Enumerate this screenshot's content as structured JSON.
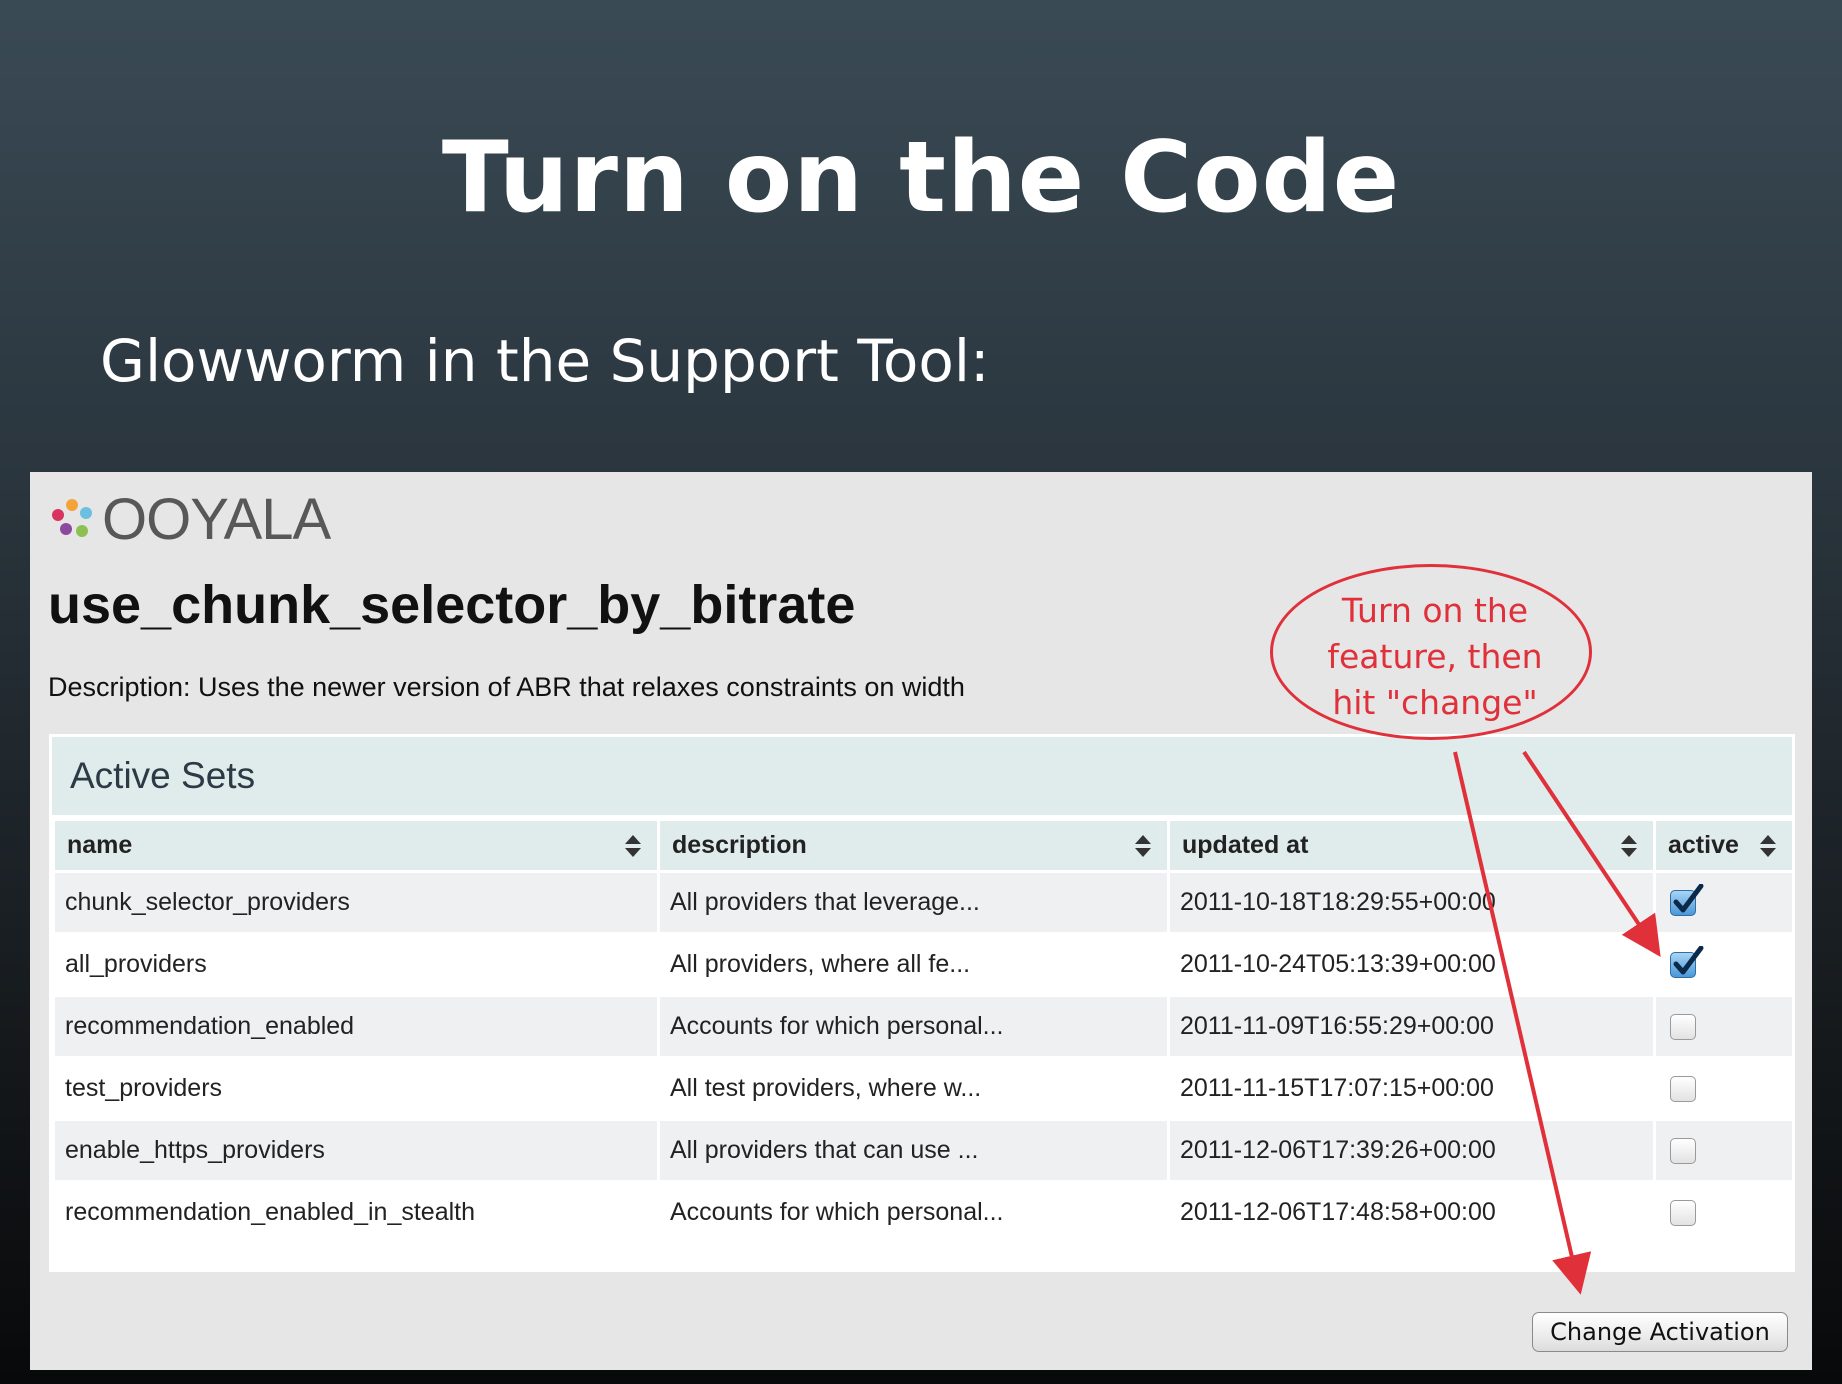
{
  "slide": {
    "title": "Turn on the Code",
    "subtitle": "Glowworm in the Support Tool:"
  },
  "app": {
    "logo_text": "OOYALA",
    "feature_title": "use_chunk_selector_by_bitrate",
    "description": "Description: Uses the newer version of ABR that relaxes constraints on width"
  },
  "panel": {
    "header": "Active Sets",
    "columns": [
      "name",
      "description",
      "updated at",
      "active"
    ],
    "rows": [
      {
        "name": "chunk_selector_providers",
        "description": "All providers that leverage...",
        "updated_at": "2011-10-18T18:29:55+00:00",
        "active": true
      },
      {
        "name": "all_providers",
        "description": "All providers, where all fe...",
        "updated_at": "2011-10-24T05:13:39+00:00",
        "active": true
      },
      {
        "name": "recommendation_enabled",
        "description": "Accounts for which personal...",
        "updated_at": "2011-11-09T16:55:29+00:00",
        "active": false
      },
      {
        "name": "test_providers",
        "description": "All test providers, where w...",
        "updated_at": "2011-11-15T17:07:15+00:00",
        "active": false
      },
      {
        "name": "enable_https_providers",
        "description": "All providers that can use ...",
        "updated_at": "2011-12-06T17:39:26+00:00",
        "active": false
      },
      {
        "name": "recommendation_enabled_in_stealth",
        "description": "Accounts for which personal...",
        "updated_at": "2011-12-06T17:48:58+00:00",
        "active": false
      }
    ]
  },
  "button": {
    "change_activation": "Change Activation"
  },
  "annotation": {
    "line1": "Turn on the",
    "line2": "feature, then",
    "line3": "hit \"change\"",
    "color": "#e0303a"
  },
  "icons": {
    "sort": "sort-arrows-icon",
    "check": "checkmark-icon",
    "logo": "ooyala-dots-logo"
  }
}
